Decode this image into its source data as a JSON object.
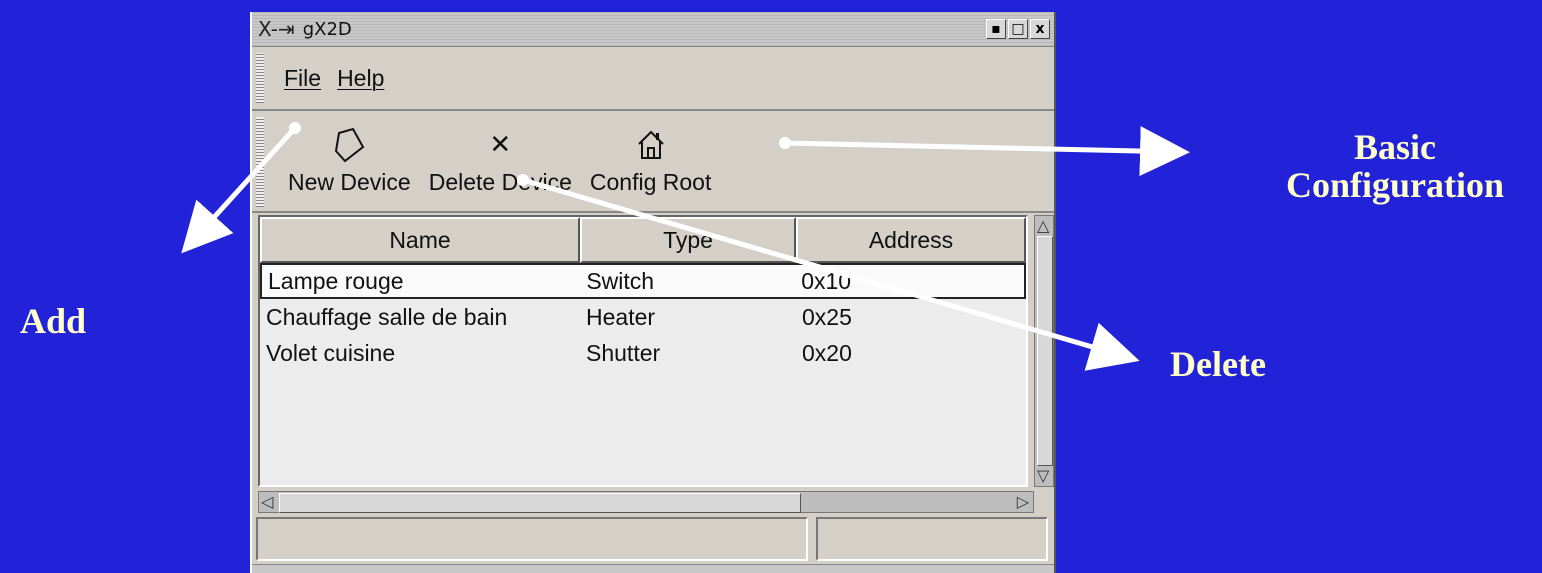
{
  "window": {
    "title": "gX2D",
    "logo_glyph": "X-⇥",
    "controls": {
      "minimize": "▪",
      "maximize": "□",
      "close": "x"
    }
  },
  "menu": [
    {
      "label": "File"
    },
    {
      "label": "Help"
    }
  ],
  "toolbar": [
    {
      "label": "New Device",
      "icon": "new-device-icon"
    },
    {
      "label": "Delete Device",
      "icon": "delete-icon",
      "glyph": "✕"
    },
    {
      "label": "Config Root",
      "icon": "home-icon"
    }
  ],
  "table": {
    "columns": [
      "Name",
      "Type",
      "Address"
    ],
    "rows": [
      {
        "name": "Lampe rouge",
        "type": "Switch",
        "address": "0x10",
        "selected": true
      },
      {
        "name": "Chauffage salle de bain",
        "type": "Heater",
        "address": "0x25",
        "selected": false
      },
      {
        "name": "Volet cuisine",
        "type": "Shutter",
        "address": "0x20",
        "selected": false
      }
    ]
  },
  "callouts": {
    "add": "Add",
    "delete": "Delete",
    "basic_line1": "Basic",
    "basic_line2": "Configuration"
  },
  "colors": {
    "background": "#2222d9",
    "callout_text": "#ffffcc",
    "arrows": "#ffffff"
  }
}
